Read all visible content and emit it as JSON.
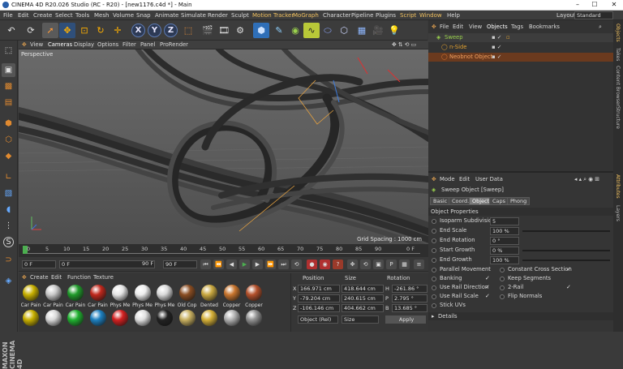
{
  "window": {
    "title": "CINEMA 4D R20.026 Studio (RC - R20) - [new1176.c4d *] - Main",
    "minimize": "–",
    "maximize": "☐",
    "close": "✕"
  },
  "menu": [
    "File",
    "Edit",
    "Create",
    "Select",
    "Tools",
    "Mesh",
    "Volume",
    "Snap",
    "Animate",
    "Simulate",
    "Render",
    "Sculpt",
    "Motion Tracker",
    "MoGraph",
    "Character",
    "Pipeline",
    "Plugins",
    "Script",
    "Window",
    "Help"
  ],
  "layout": {
    "label": "Layout:",
    "value": "Standard"
  },
  "toolbar_icons": [
    "undo-icon",
    "cursor-icon",
    "move-icon",
    "scale-icon",
    "rotate-icon",
    "transform-icon",
    "x-axis-icon",
    "y-axis-icon",
    "z-axis-icon",
    "coordinate-system-icon",
    "render-region-icon",
    "render-view-icon",
    "render-settings-icon",
    "cube-icon",
    "pen-icon",
    "subdivision-icon",
    "spline-icon",
    "nurbs-icon",
    "array-icon",
    "floor-icon",
    "camera-icon",
    "light-icon"
  ],
  "axes": {
    "x": "X",
    "y": "Y",
    "z": "Z"
  },
  "viewport": {
    "menu": [
      "View",
      "Cameras",
      "Display",
      "Options",
      "Filter",
      "Panel",
      "ProRender"
    ],
    "label": "Perspective",
    "grid_spacing": "Grid Spacing : 1000 cm"
  },
  "timeline": {
    "ticks": [
      "0",
      "5",
      "10",
      "15",
      "20",
      "25",
      "30",
      "35",
      "40",
      "45",
      "50",
      "55",
      "60",
      "65",
      "70",
      "75",
      "80",
      "85",
      "90"
    ],
    "end_label": "0 F"
  },
  "transport": {
    "start": "0 F",
    "current": "0 F",
    "min": "90 F",
    "max": "90 F"
  },
  "materials": {
    "menu": [
      "Create",
      "Edit",
      "Function",
      "Texture"
    ],
    "row1": [
      {
        "label": "Car Pain",
        "color": "#c8b000"
      },
      {
        "label": "Car Pain",
        "color": "#c8c8c8"
      },
      {
        "label": "Car Pain",
        "color": "#1f9a2a"
      },
      {
        "label": "Car Pain",
        "color": "#c0281c"
      },
      {
        "label": "Phys Me",
        "color": "#e6e6e6"
      },
      {
        "label": "Phys Me",
        "color": "#ededed"
      },
      {
        "label": "Phys Me",
        "color": "#d9d9d9"
      },
      {
        "label": "Old Cop",
        "color": "#8a4d22"
      },
      {
        "label": "Dented",
        "color": "#c9a840"
      },
      {
        "label": "Copper",
        "color": "#c8752e"
      },
      {
        "label": "Copper",
        "color": "#b3502b"
      }
    ],
    "row2": [
      {
        "color": "#c8b000"
      },
      {
        "color": "#d8d8d8"
      },
      {
        "color": "#20b030"
      },
      {
        "color": "#1d7fbf"
      },
      {
        "color": "#d32020"
      },
      {
        "color": "#e0e0e0"
      },
      {
        "color": "#222222"
      },
      {
        "color": "#c8b060"
      },
      {
        "color": "#d4af37"
      },
      {
        "color": "#b0b0b0"
      },
      {
        "color": "#909090"
      }
    ]
  },
  "coords": {
    "headers": {
      "position": "Position",
      "size": "Size",
      "rotation": "Rotation"
    },
    "rows": [
      {
        "axis": "X",
        "pos": "166.971 cm",
        "size": "418.644 cm",
        "rot_axis": "H",
        "rot": "-261.86 °"
      },
      {
        "axis": "Y",
        "pos": "-79.204 cm",
        "size": "240.615 cm",
        "rot_axis": "P",
        "rot": "2.795 °"
      },
      {
        "axis": "Z",
        "pos": "-106.146 cm",
        "size": "404.662 cm",
        "rot_axis": "B",
        "rot": "13.685 °"
      }
    ],
    "mode": "Object (Rel)",
    "size_mode": "Size",
    "apply": "Apply"
  },
  "objects": {
    "menu": [
      "File",
      "Edit",
      "View",
      "Objects",
      "Tags",
      "Bookmarks"
    ],
    "items": [
      {
        "name": "Sweep",
        "color": "#9ad14d"
      },
      {
        "name": "n-Side",
        "color": "#e0a030"
      },
      {
        "name": "Neobnot Object",
        "color": "#e07a30"
      }
    ]
  },
  "attributes": {
    "menu": [
      "Mode",
      "Edit",
      "User Data"
    ],
    "object_title": "Sweep Object [Sweep]",
    "tabs": [
      "Basic",
      "Coord.",
      "Object",
      "Caps",
      "Phong"
    ],
    "active_tab": "Object",
    "section": "Object Properties",
    "fields": [
      {
        "label": "Isoparm Subdivision",
        "value": "5"
      },
      {
        "label": "End Scale",
        "value": "100 %"
      },
      {
        "label": "End Rotation",
        "value": "0 °"
      },
      {
        "label": "Start Growth",
        "value": "0 %"
      },
      {
        "label": "End Growth",
        "value": "100 %"
      }
    ],
    "checks_left": [
      {
        "label": "Parallel Movement",
        "checked": ""
      },
      {
        "label": "Banking",
        "checked": "✓"
      },
      {
        "label": "Use Rail Direction",
        "checked": "✓"
      },
      {
        "label": "Use Rail Scale",
        "checked": "✓"
      },
      {
        "label": "Stick UVs",
        "checked": ""
      }
    ],
    "checks_right": [
      {
        "label": "Constant Cross Section",
        "checked": "✓"
      },
      {
        "label": "Keep Segments",
        "checked": ""
      },
      {
        "label": "2-Rail",
        "checked": "✓"
      },
      {
        "label": "Flip Normals",
        "checked": ""
      }
    ],
    "details": "Details"
  },
  "right_tabs": [
    "Objects",
    "Takes",
    "Content Browser",
    "Structure",
    "Attributes",
    "Layers"
  ],
  "brand": "MAXON CINEMA 4D"
}
